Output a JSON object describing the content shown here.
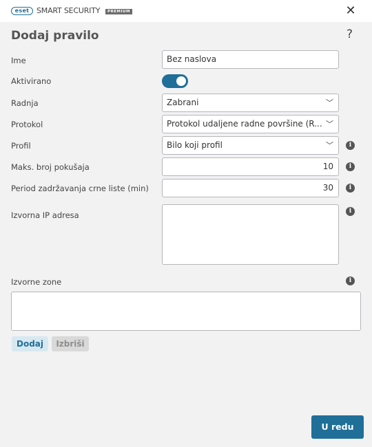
{
  "app": {
    "brand": "eset",
    "product": "SMART SECURITY",
    "tier": "PREMIUM"
  },
  "icons": {
    "close": "close-icon",
    "help": "help-icon",
    "info": "info-icon",
    "chevron": "chevron-down-icon"
  },
  "colors": {
    "accent": "#1f6f98"
  },
  "dialog": {
    "title": "Dodaj pravilo",
    "help": "?"
  },
  "form": {
    "name": {
      "label": "Ime",
      "value": "Bez naslova"
    },
    "enabled": {
      "label": "Aktivirano",
      "on": true
    },
    "action": {
      "label": "Radnja",
      "value": "Zabrani"
    },
    "protocol": {
      "label": "Protokol",
      "value": "Protokol udaljene radne površine (R..."
    },
    "profile": {
      "label": "Profil",
      "value": "Bilo koji profil"
    },
    "max_attempts": {
      "label": "Maks. broj pokušaja",
      "value": "10"
    },
    "blacklist_period": {
      "label": "Period zadržavanja crne liste (min)",
      "value": "30"
    },
    "source_ip": {
      "label": "Izvorna IP adresa",
      "value": ""
    },
    "source_zones": {
      "label": "Izvorne zone"
    }
  },
  "buttons": {
    "add": "Dodaj",
    "delete": "Izbriši",
    "ok": "U redu"
  }
}
